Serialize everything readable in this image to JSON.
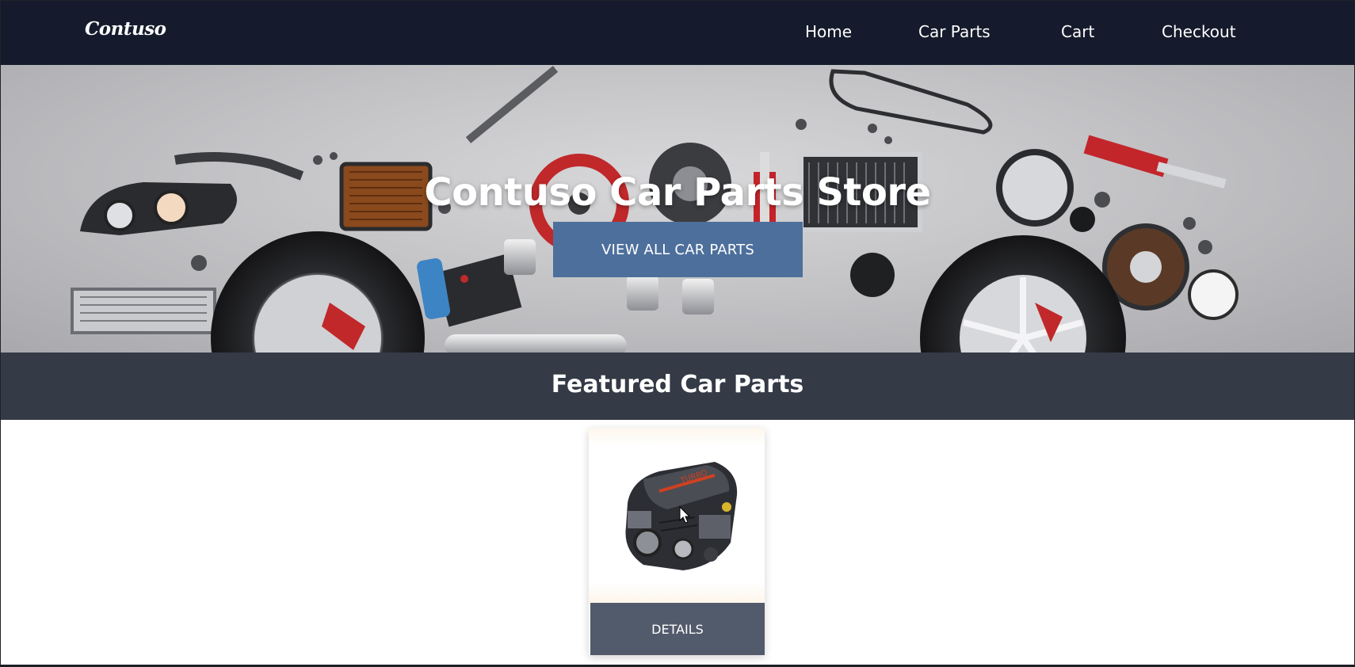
{
  "header": {
    "brand": "Contuso",
    "nav": [
      {
        "label": "Home"
      },
      {
        "label": "Car Parts"
      },
      {
        "label": "Cart"
      },
      {
        "label": "Checkout"
      }
    ]
  },
  "hero": {
    "title": "Contuso Car Parts Store",
    "cta_label": "VIEW ALL CAR PARTS"
  },
  "featured": {
    "heading": "Featured Car Parts",
    "products": [
      {
        "image_alt": "engine",
        "details_label": "DETAILS"
      }
    ]
  },
  "colors": {
    "navbar": "#151b2c",
    "cta": "#4d6f9c",
    "featured_bar": "#343a46",
    "details_button": "#525b6b"
  }
}
